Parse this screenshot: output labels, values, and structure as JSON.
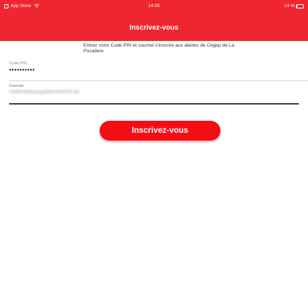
{
  "status_bar": {
    "back_app": "App Store",
    "time": "14:05",
    "battery": "14 %",
    "back_icon": "app-store-back-icon",
    "wifi_icon": "wifi-icon",
    "battery_icon": "battery-icon"
  },
  "header": {
    "title": "Inscrivez-vous",
    "background_color": "#ef2630"
  },
  "description": "Entrez votre Code PIN et courriel s'inscrire aux alertes de Cegep de La Pocatiere",
  "form": {
    "pin": {
      "label": "Code PIN",
      "value": "••••••••••"
    },
    "email": {
      "label": "Courriel",
      "value": "hhbbhhbbbaagddphhhbhhhb.bb"
    }
  },
  "submit": {
    "label": "Inscrivez-vous",
    "color": "#f50d14"
  }
}
